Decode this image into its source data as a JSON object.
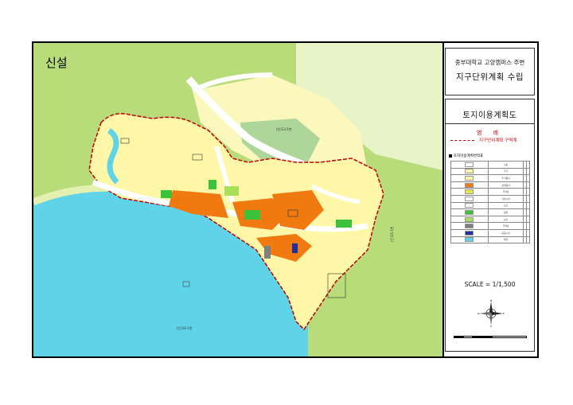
{
  "map": {
    "label": "신설",
    "road_label_1": "(인)13-1번",
    "road_label_2": "(인)15-1번",
    "road_label_3": "(인)16-1번",
    "colors": {
      "water": "#5fd3e8",
      "forest": "#b8dc7a",
      "residential": "#fff7a8",
      "commercial": "#f07a10",
      "park": "#39c23a",
      "road": "#ffffff",
      "boundary": "#c00000"
    }
  },
  "panel": {
    "subtitle": "중부대학교 고양캠퍼스 주변",
    "title": "지구단위계획 수립",
    "plan_title": "토지이용계획도",
    "legend_title": "범 례",
    "legend_boundary_label": "지구단위계획 구역계",
    "table_title": "토지이용계획면적표",
    "table_rows": [
      {
        "color": "#ffffff",
        "name": "구분"
      },
      {
        "color": "#fff7a8",
        "name": "주거"
      },
      {
        "color": "#fff7a8",
        "name": "주거용지"
      },
      {
        "color": "#f07a10",
        "name": "상업용지"
      },
      {
        "color": "#e6e64a",
        "name": "주차장"
      },
      {
        "color": "#ffffff",
        "name": "기반시설"
      },
      {
        "color": "#ffffff",
        "name": "도로"
      },
      {
        "color": "#39c23a",
        "name": "공원"
      },
      {
        "color": "#a8e05a",
        "name": "녹지"
      },
      {
        "color": "#808080",
        "name": "주차장"
      },
      {
        "color": "#1f2fa0",
        "name": "공공시설"
      },
      {
        "color": "#5fd3e8",
        "name": "하천"
      }
    ],
    "scale": "SCALE = 1/1,500",
    "compass": {
      "n": "N",
      "s": "S",
      "e": "E",
      "w": "W"
    }
  }
}
